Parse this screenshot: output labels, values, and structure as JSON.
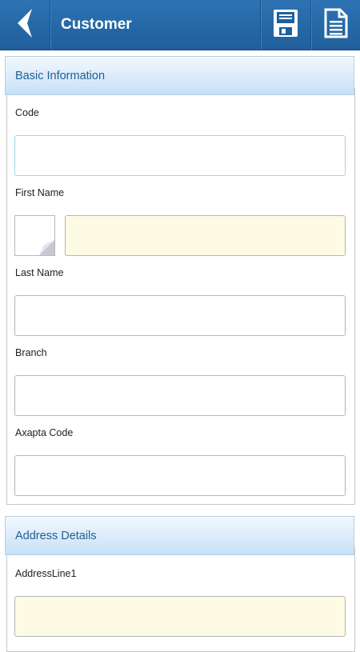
{
  "header": {
    "title": "Customer",
    "back_icon": "back-chevron-icon",
    "save_icon": "floppy-disk-icon",
    "document_icon": "document-icon"
  },
  "basic_section": {
    "title": "Basic Information",
    "code_label": "Code",
    "first_name_label": "First Name",
    "last_name_label": "Last Name",
    "branch_label": "Branch",
    "axapta_label": "Axapta Code"
  },
  "address_section": {
    "title": "Address Details",
    "address1_label": "AddressLine1"
  },
  "colors": {
    "header_bg": "#2468a8",
    "section_title": "#1f5f94",
    "required_field_bg": "#fefbe4"
  }
}
